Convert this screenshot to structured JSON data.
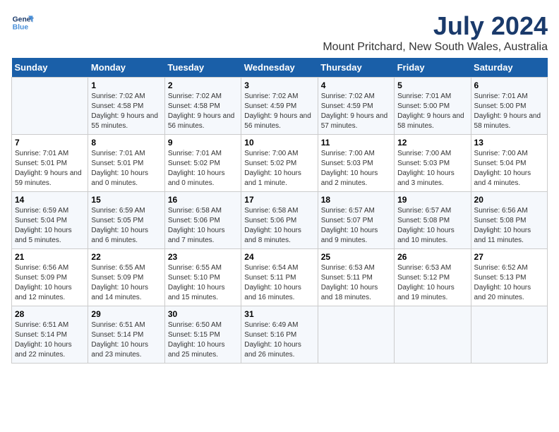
{
  "logo": {
    "line1": "General",
    "line2": "Blue"
  },
  "title": "July 2024",
  "subtitle": "Mount Pritchard, New South Wales, Australia",
  "days_header": [
    "Sunday",
    "Monday",
    "Tuesday",
    "Wednesday",
    "Thursday",
    "Friday",
    "Saturday"
  ],
  "weeks": [
    [
      {
        "num": "",
        "sunrise": "",
        "sunset": "",
        "daylight": ""
      },
      {
        "num": "1",
        "sunrise": "Sunrise: 7:02 AM",
        "sunset": "Sunset: 4:58 PM",
        "daylight": "Daylight: 9 hours and 55 minutes."
      },
      {
        "num": "2",
        "sunrise": "Sunrise: 7:02 AM",
        "sunset": "Sunset: 4:58 PM",
        "daylight": "Daylight: 9 hours and 56 minutes."
      },
      {
        "num": "3",
        "sunrise": "Sunrise: 7:02 AM",
        "sunset": "Sunset: 4:59 PM",
        "daylight": "Daylight: 9 hours and 56 minutes."
      },
      {
        "num": "4",
        "sunrise": "Sunrise: 7:02 AM",
        "sunset": "Sunset: 4:59 PM",
        "daylight": "Daylight: 9 hours and 57 minutes."
      },
      {
        "num": "5",
        "sunrise": "Sunrise: 7:01 AM",
        "sunset": "Sunset: 5:00 PM",
        "daylight": "Daylight: 9 hours and 58 minutes."
      },
      {
        "num": "6",
        "sunrise": "Sunrise: 7:01 AM",
        "sunset": "Sunset: 5:00 PM",
        "daylight": "Daylight: 9 hours and 58 minutes."
      }
    ],
    [
      {
        "num": "7",
        "sunrise": "Sunrise: 7:01 AM",
        "sunset": "Sunset: 5:01 PM",
        "daylight": "Daylight: 9 hours and 59 minutes."
      },
      {
        "num": "8",
        "sunrise": "Sunrise: 7:01 AM",
        "sunset": "Sunset: 5:01 PM",
        "daylight": "Daylight: 10 hours and 0 minutes."
      },
      {
        "num": "9",
        "sunrise": "Sunrise: 7:01 AM",
        "sunset": "Sunset: 5:02 PM",
        "daylight": "Daylight: 10 hours and 0 minutes."
      },
      {
        "num": "10",
        "sunrise": "Sunrise: 7:00 AM",
        "sunset": "Sunset: 5:02 PM",
        "daylight": "Daylight: 10 hours and 1 minute."
      },
      {
        "num": "11",
        "sunrise": "Sunrise: 7:00 AM",
        "sunset": "Sunset: 5:03 PM",
        "daylight": "Daylight: 10 hours and 2 minutes."
      },
      {
        "num": "12",
        "sunrise": "Sunrise: 7:00 AM",
        "sunset": "Sunset: 5:03 PM",
        "daylight": "Daylight: 10 hours and 3 minutes."
      },
      {
        "num": "13",
        "sunrise": "Sunrise: 7:00 AM",
        "sunset": "Sunset: 5:04 PM",
        "daylight": "Daylight: 10 hours and 4 minutes."
      }
    ],
    [
      {
        "num": "14",
        "sunrise": "Sunrise: 6:59 AM",
        "sunset": "Sunset: 5:04 PM",
        "daylight": "Daylight: 10 hours and 5 minutes."
      },
      {
        "num": "15",
        "sunrise": "Sunrise: 6:59 AM",
        "sunset": "Sunset: 5:05 PM",
        "daylight": "Daylight: 10 hours and 6 minutes."
      },
      {
        "num": "16",
        "sunrise": "Sunrise: 6:58 AM",
        "sunset": "Sunset: 5:06 PM",
        "daylight": "Daylight: 10 hours and 7 minutes."
      },
      {
        "num": "17",
        "sunrise": "Sunrise: 6:58 AM",
        "sunset": "Sunset: 5:06 PM",
        "daylight": "Daylight: 10 hours and 8 minutes."
      },
      {
        "num": "18",
        "sunrise": "Sunrise: 6:57 AM",
        "sunset": "Sunset: 5:07 PM",
        "daylight": "Daylight: 10 hours and 9 minutes."
      },
      {
        "num": "19",
        "sunrise": "Sunrise: 6:57 AM",
        "sunset": "Sunset: 5:08 PM",
        "daylight": "Daylight: 10 hours and 10 minutes."
      },
      {
        "num": "20",
        "sunrise": "Sunrise: 6:56 AM",
        "sunset": "Sunset: 5:08 PM",
        "daylight": "Daylight: 10 hours and 11 minutes."
      }
    ],
    [
      {
        "num": "21",
        "sunrise": "Sunrise: 6:56 AM",
        "sunset": "Sunset: 5:09 PM",
        "daylight": "Daylight: 10 hours and 12 minutes."
      },
      {
        "num": "22",
        "sunrise": "Sunrise: 6:55 AM",
        "sunset": "Sunset: 5:09 PM",
        "daylight": "Daylight: 10 hours and 14 minutes."
      },
      {
        "num": "23",
        "sunrise": "Sunrise: 6:55 AM",
        "sunset": "Sunset: 5:10 PM",
        "daylight": "Daylight: 10 hours and 15 minutes."
      },
      {
        "num": "24",
        "sunrise": "Sunrise: 6:54 AM",
        "sunset": "Sunset: 5:11 PM",
        "daylight": "Daylight: 10 hours and 16 minutes."
      },
      {
        "num": "25",
        "sunrise": "Sunrise: 6:53 AM",
        "sunset": "Sunset: 5:11 PM",
        "daylight": "Daylight: 10 hours and 18 minutes."
      },
      {
        "num": "26",
        "sunrise": "Sunrise: 6:53 AM",
        "sunset": "Sunset: 5:12 PM",
        "daylight": "Daylight: 10 hours and 19 minutes."
      },
      {
        "num": "27",
        "sunrise": "Sunrise: 6:52 AM",
        "sunset": "Sunset: 5:13 PM",
        "daylight": "Daylight: 10 hours and 20 minutes."
      }
    ],
    [
      {
        "num": "28",
        "sunrise": "Sunrise: 6:51 AM",
        "sunset": "Sunset: 5:14 PM",
        "daylight": "Daylight: 10 hours and 22 minutes."
      },
      {
        "num": "29",
        "sunrise": "Sunrise: 6:51 AM",
        "sunset": "Sunset: 5:14 PM",
        "daylight": "Daylight: 10 hours and 23 minutes."
      },
      {
        "num": "30",
        "sunrise": "Sunrise: 6:50 AM",
        "sunset": "Sunset: 5:15 PM",
        "daylight": "Daylight: 10 hours and 25 minutes."
      },
      {
        "num": "31",
        "sunrise": "Sunrise: 6:49 AM",
        "sunset": "Sunset: 5:16 PM",
        "daylight": "Daylight: 10 hours and 26 minutes."
      },
      {
        "num": "",
        "sunrise": "",
        "sunset": "",
        "daylight": ""
      },
      {
        "num": "",
        "sunrise": "",
        "sunset": "",
        "daylight": ""
      },
      {
        "num": "",
        "sunrise": "",
        "sunset": "",
        "daylight": ""
      }
    ]
  ]
}
